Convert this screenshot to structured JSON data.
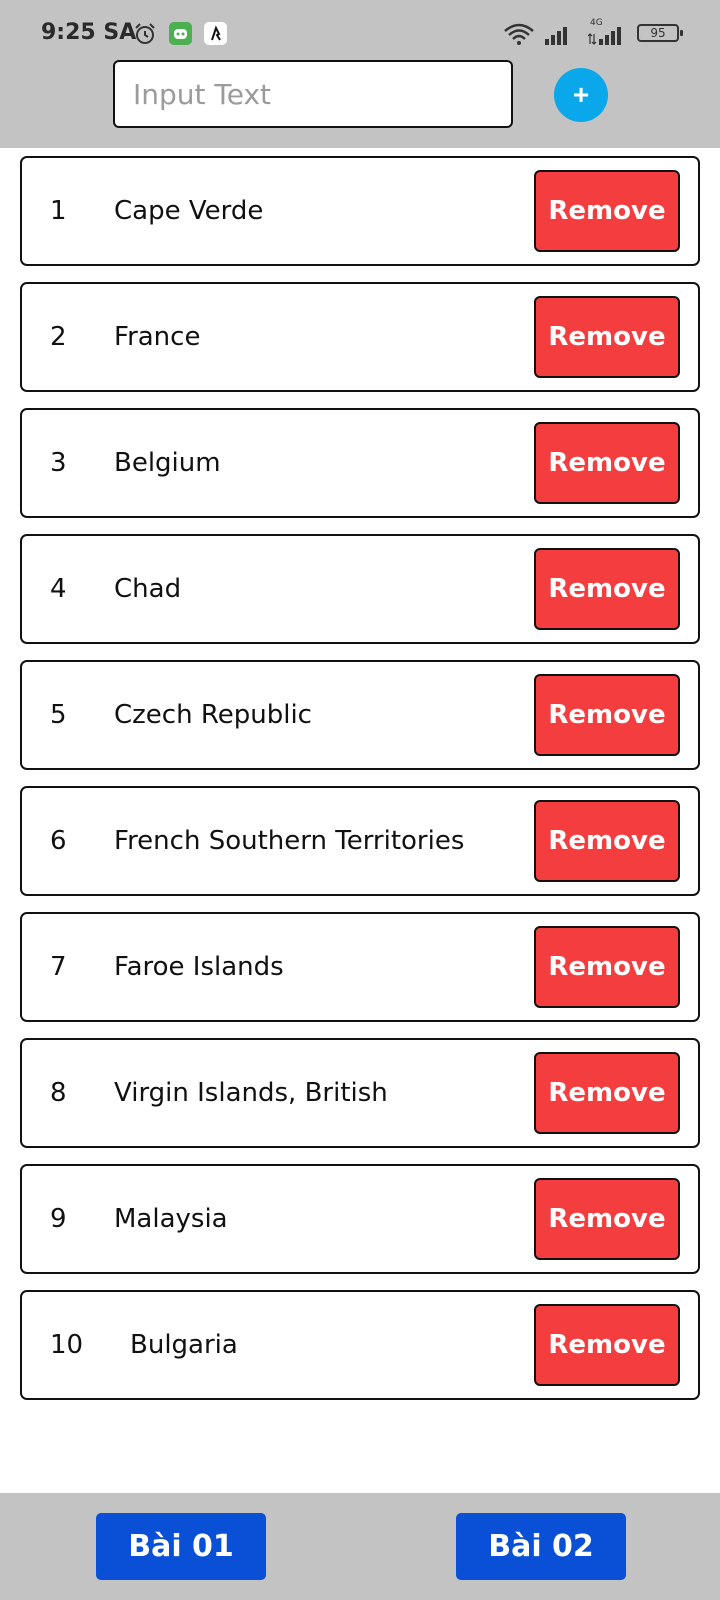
{
  "status_bar": {
    "time": "9:25 SA",
    "network_label": "4G",
    "battery": "95"
  },
  "input": {
    "placeholder": "Input Text",
    "value": ""
  },
  "add_button_label": "+",
  "items": [
    {
      "index": "1",
      "name": "Cape Verde",
      "remove_label": "Remove"
    },
    {
      "index": "2",
      "name": "France",
      "remove_label": "Remove"
    },
    {
      "index": "3",
      "name": "Belgium",
      "remove_label": "Remove"
    },
    {
      "index": "4",
      "name": "Chad",
      "remove_label": "Remove"
    },
    {
      "index": "5",
      "name": "Czech Republic",
      "remove_label": "Remove"
    },
    {
      "index": "6",
      "name": "French Southern Territories",
      "remove_label": "Remove"
    },
    {
      "index": "7",
      "name": "Faroe Islands",
      "remove_label": "Remove"
    },
    {
      "index": "8",
      "name": "Virgin Islands, British",
      "remove_label": "Remove"
    },
    {
      "index": "9",
      "name": "Malaysia",
      "remove_label": "Remove"
    },
    {
      "index": "10",
      "name": "Bulgaria",
      "remove_label": "Remove"
    }
  ],
  "bottom_nav": {
    "bai01": "Bài 01",
    "bai02": "Bài 02"
  },
  "colors": {
    "header_bg": "#c3c3c3",
    "add_button": "#0aa8ea",
    "remove_button": "#f43d3f",
    "nav_button": "#0950d6"
  }
}
